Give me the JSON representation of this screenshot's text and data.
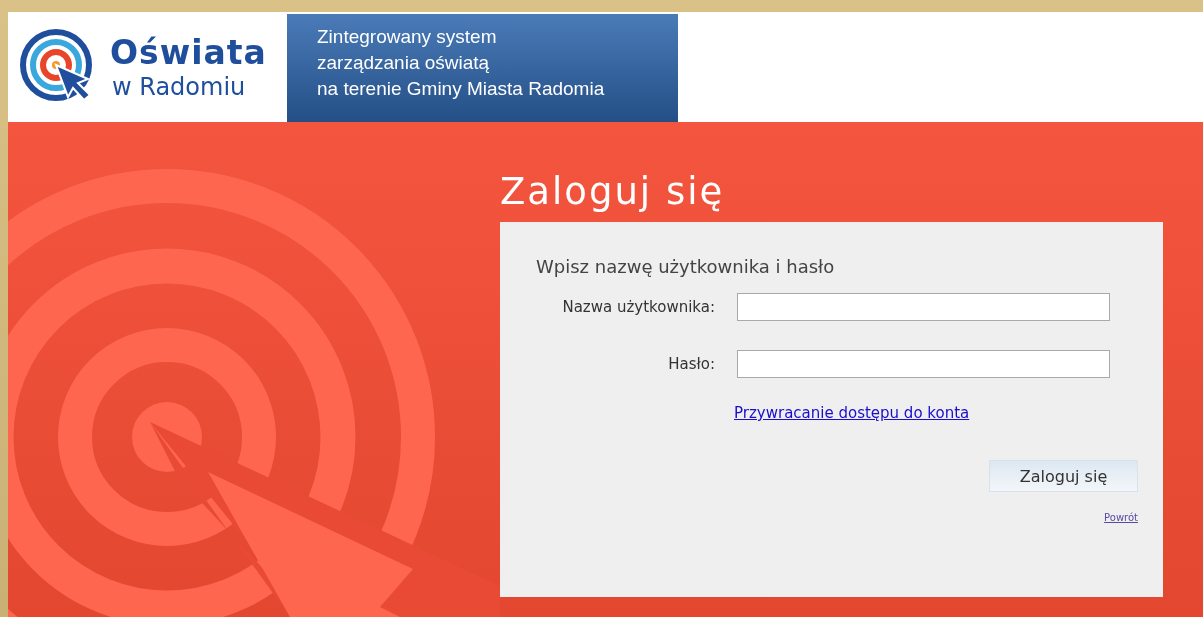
{
  "header": {
    "logo_title": "Oświata",
    "logo_subtitle": "w Radomiu",
    "tagline": "Zintegrowany system\nzarządzania oświatą\nna terenie Gminy Miasta Radomia"
  },
  "login": {
    "title": "Zaloguj się",
    "heading": "Wpisz nazwę użytkownika i hasło",
    "fields": [
      {
        "label": "Nazwa użytkownika:"
      },
      {
        "label": "Hasło:"
      }
    ],
    "recovery_link": "Przywracanie dostępu do konta",
    "submit_button": "Zaloguj się",
    "back_link": "Powrót"
  }
}
